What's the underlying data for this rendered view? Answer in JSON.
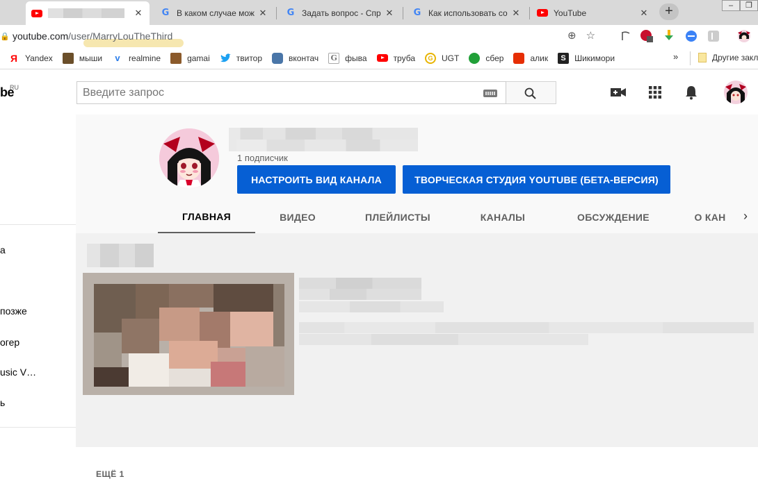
{
  "browser": {
    "tabs": [
      {
        "title": "",
        "favicon": "youtube-icon",
        "active": true
      },
      {
        "title": "В каком случае можно",
        "favicon": "google-icon",
        "active": false
      },
      {
        "title": "Задать вопрос - Справ",
        "favicon": "google-icon",
        "active": false
      },
      {
        "title": "Как использовать собс",
        "favicon": "google-icon",
        "active": false
      },
      {
        "title": "YouTube",
        "favicon": "youtube-icon",
        "active": false
      }
    ],
    "close_glyph": "✕",
    "new_tab_glyph": "+",
    "address": {
      "host": "youtube.com",
      "path": "/user/MarryLouTheThird"
    },
    "bookmarks": [
      {
        "label": "Yandex",
        "icon": "yandex-icon",
        "glyph": "Я",
        "color": "#ff0000"
      },
      {
        "label": "мыши",
        "icon": "mouse-icon",
        "glyph": "",
        "color": "#6b4f2a"
      },
      {
        "label": "realmine",
        "icon": "realmine-icon",
        "glyph": "v",
        "color": "#2b7de9"
      },
      {
        "label": "gamai",
        "icon": "gamai-icon",
        "glyph": "",
        "color": "#8b5a2b"
      },
      {
        "label": "твитор",
        "icon": "twitter-icon",
        "glyph": "t",
        "color": "#1da1f2"
      },
      {
        "label": "вконтач",
        "icon": "chat-icon",
        "glyph": "",
        "color": "#4a76a8"
      },
      {
        "label": "фыва",
        "icon": "g-icon",
        "glyph": "G",
        "color": "#777777"
      },
      {
        "label": "труба",
        "icon": "youtube-icon",
        "glyph": "",
        "color": "#ff0000"
      },
      {
        "label": "UGT",
        "icon": "ugt-icon",
        "glyph": "G",
        "color": "#e8b400"
      },
      {
        "label": "сбер",
        "icon": "sber-icon",
        "glyph": "",
        "color": "#21a038"
      },
      {
        "label": "алик",
        "icon": "aliexpress-icon",
        "glyph": "",
        "color": "#e62e04"
      },
      {
        "label": "Шикимори",
        "icon": "shikimori-icon",
        "glyph": "S",
        "color": "#222222"
      }
    ],
    "bookmarks_more": "»",
    "other_bookmarks": "Другие закла"
  },
  "youtube": {
    "logo_tail": "be",
    "logo_region": "RU",
    "search_placeholder": "Введите запрос",
    "guide_items": [
      "а",
      "позже",
      "огер",
      "usic V…",
      "ь"
    ],
    "channel": {
      "subscribers": "1 подписчик",
      "customize_button": "НАСТРОИТЬ ВИД КАНАЛА",
      "studio_button": "ТВОРЧЕСКАЯ СТУДИЯ YOUTUBE (БЕТА-ВЕРСИЯ)",
      "tabs": [
        "ГЛАВНАЯ",
        "ВИДЕО",
        "ПЛЕЙЛИСТЫ",
        "КАНАЛЫ",
        "ОБСУЖДЕНИЕ",
        "О КАН"
      ],
      "active_tab": "ГЛАВНАЯ"
    },
    "shelf_more": "ЕЩЁ 1",
    "colors": {
      "accent_blue": "#065fd4",
      "brand_red": "#ff0000"
    }
  }
}
